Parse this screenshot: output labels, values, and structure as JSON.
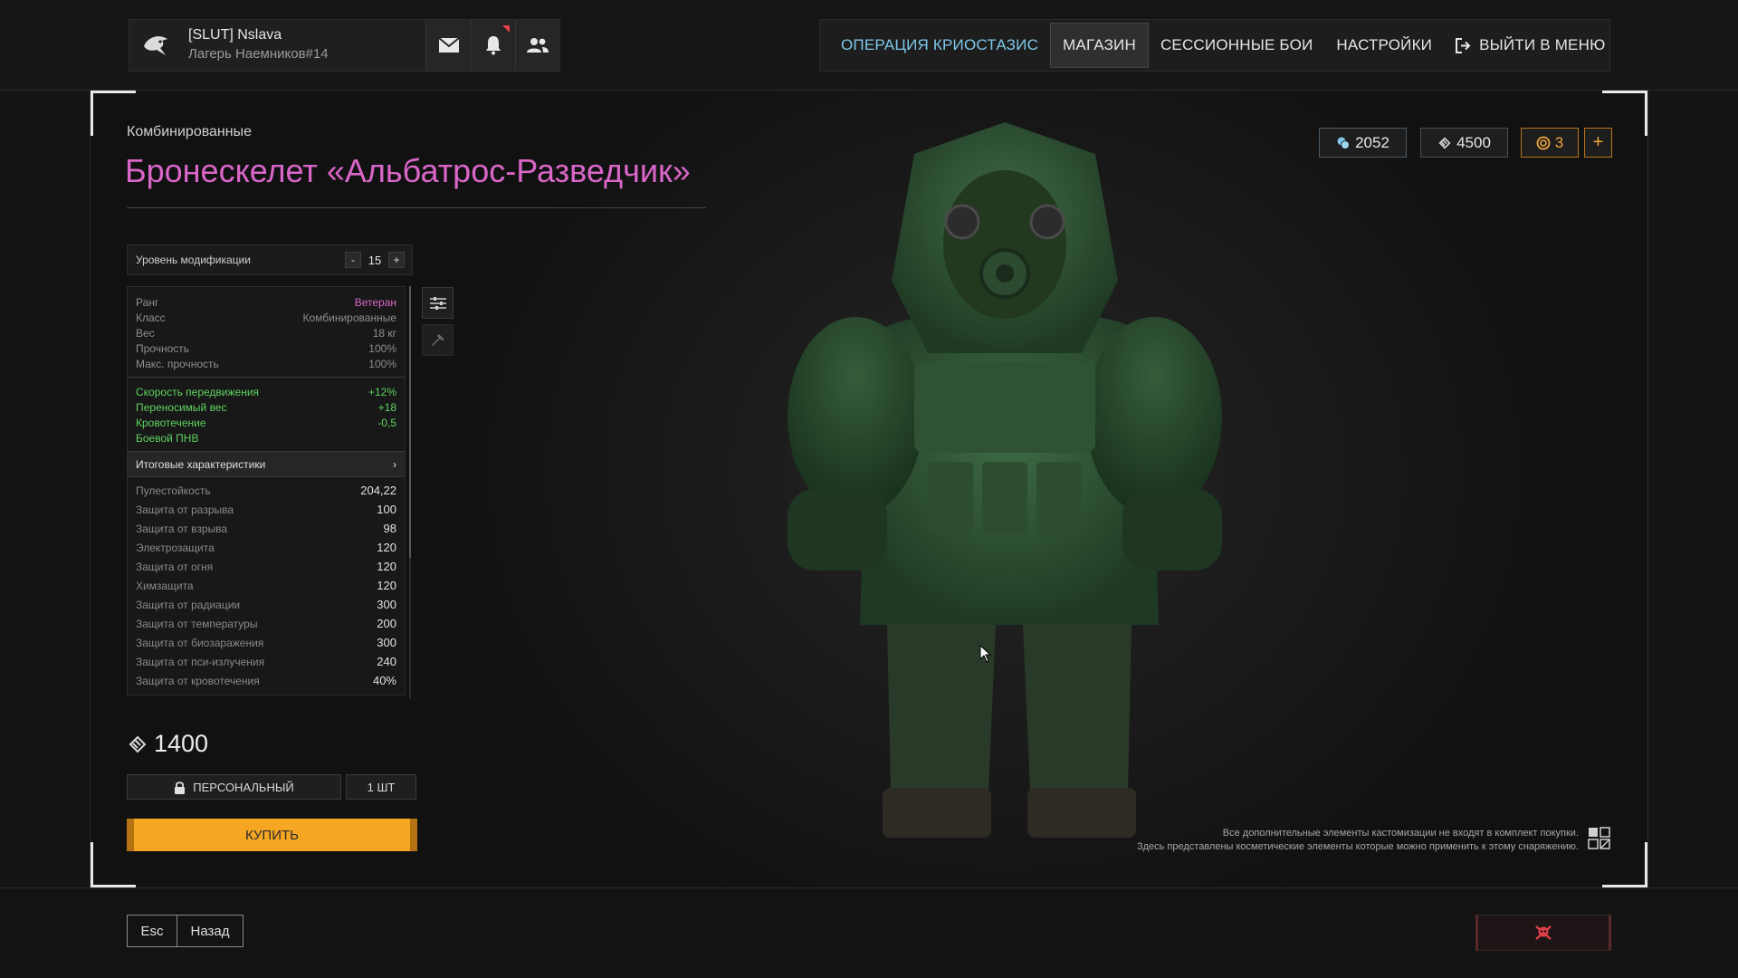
{
  "profile": {
    "name": "[SLUT] Nslava",
    "subtitle": "Лагерь Наемников#14"
  },
  "nav": {
    "items": [
      {
        "label": "ОПЕРАЦИЯ КРИОСТАЗИС"
      },
      {
        "label": "МАГАЗИН"
      },
      {
        "label": "СЕССИОННЫЕ БОИ"
      },
      {
        "label": "НАСТРОЙКИ"
      },
      {
        "label": "ВЫЙТИ В МЕНЮ"
      }
    ]
  },
  "item": {
    "category": "Комбинированные",
    "title": "Бронескелет «Альбатрос-Разведчик»"
  },
  "modification": {
    "label": "Уровень модификации",
    "minus": "-",
    "value": "15",
    "plus": "+"
  },
  "stats": {
    "base": [
      {
        "label": "Ранг",
        "value": "Ветеран"
      },
      {
        "label": "Класс",
        "value": "Комбинированные"
      },
      {
        "label": "Вес",
        "value": "18 кг"
      },
      {
        "label": "Прочность",
        "value": "100%"
      },
      {
        "label": "Макс. прочность",
        "value": "100%"
      }
    ],
    "bonuses": [
      {
        "label": "Скорость передвижения",
        "value": "+12%"
      },
      {
        "label": "Переносимый вес",
        "value": "+18"
      },
      {
        "label": "Кровотечение",
        "value": "-0,5"
      },
      {
        "label": "Боевой ПНВ",
        "value": ""
      }
    ],
    "summary_header": "Итоговые характеристики",
    "summary_arrow": "›",
    "resistances": [
      {
        "label": "Пулестойкость",
        "value": "204,22"
      },
      {
        "label": "Защита от разрыва",
        "value": "100"
      },
      {
        "label": "Защита от взрыва",
        "value": "98"
      },
      {
        "label": "Электрозащита",
        "value": "120"
      },
      {
        "label": "Защита от огня",
        "value": "120"
      },
      {
        "label": "Химзащита",
        "value": "120"
      },
      {
        "label": "Защита от радиации",
        "value": "300"
      },
      {
        "label": "Защита от температуры",
        "value": "200"
      },
      {
        "label": "Защита от биозаражения",
        "value": "300"
      },
      {
        "label": "Защита от пси-излучения",
        "value": "240"
      },
      {
        "label": "Защита от кровотечения",
        "value": "40%"
      }
    ]
  },
  "purchase": {
    "price": "1400",
    "personal_label": "ПЕРСОНАЛЬНЫЙ",
    "quantity": "1 ШТ",
    "buy_label": "КУПИТЬ"
  },
  "currencies": {
    "silver": "2052",
    "rubles": "4500",
    "gold": "3",
    "add": "+"
  },
  "disclaimer": {
    "line1": "Все дополнительные элементы кастомизации не входят в комплект покупки.",
    "line2": "Здесь представлены косметические элементы которые можно применить к этому снаряжению."
  },
  "footer": {
    "esc": "Esc",
    "back": "Назад"
  },
  "colors": {
    "accent_blue": "#7ec8ea",
    "rank_pink": "#d966c8",
    "bonus_green": "#5fd35f",
    "buy_orange": "#f5a623",
    "gold": "#f0a43a"
  }
}
